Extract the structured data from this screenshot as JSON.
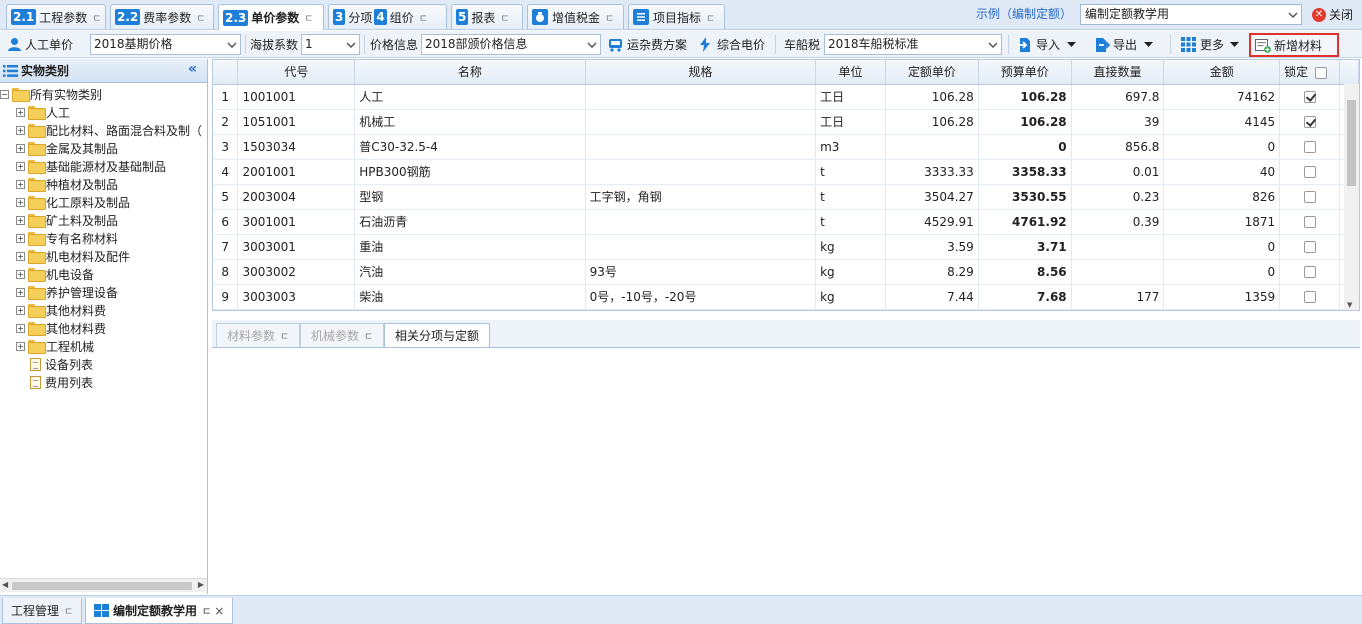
{
  "top_tabs": [
    {
      "num": "2.1",
      "label": "工程参数"
    },
    {
      "num": "2.2",
      "label": "费率参数"
    },
    {
      "num": "2.3",
      "label": "单价参数"
    },
    {
      "num": "3",
      "label": "分项",
      "num2": "4",
      "label2": "组价"
    },
    {
      "num": "5",
      "label": "报表"
    },
    {
      "label": "增值税金"
    },
    {
      "label": "项目指标"
    }
  ],
  "tab_pin_glyph": "ㄷ",
  "demo_label": "示例（编制定额）",
  "project_select": "编制定额教学用",
  "close_label": "关闭",
  "toolbar": {
    "labor_price": "人工单价",
    "labor_price_value": "2018基期价格",
    "altitude_label": "海拔系数",
    "altitude_value": "1",
    "price_info_label": "价格信息",
    "price_info_value": "2018部颁价格信息",
    "freight_label": "运杂费方案",
    "power_label": "综合电价",
    "vehicle_tax_label": "车船税",
    "vehicle_tax_value": "2018车船税标准",
    "import_label": "导入",
    "export_label": "导出",
    "more_label": "更多",
    "new_material_label": "新增材料"
  },
  "left_panel": {
    "title": "实物类别",
    "root": "所有实物类别",
    "items": [
      "人工",
      "配比材料、路面混合料及制（",
      "金属及其制品",
      "基础能源材及基础制品",
      "种植材及制品",
      "化工原料及制品",
      "矿土料及制品",
      "专有名称材料",
      "机电材料及配件",
      "机电设备",
      "养护管理设备",
      "其他材料费",
      "其他材料费",
      "工程机械"
    ],
    "leaf_items": [
      "设备列表",
      "费用列表"
    ]
  },
  "grid": {
    "columns": [
      "代号",
      "名称",
      "规格",
      "单位",
      "定额单价",
      "预算单价",
      "直接数量",
      "金额",
      "锁定"
    ],
    "rows": [
      {
        "n": "1",
        "code": "1001001",
        "name": "人工",
        "spec": "",
        "unit": "工日",
        "quota": "106.28",
        "budget": "106.28",
        "qty": "697.8",
        "amount": "74162",
        "locked": true
      },
      {
        "n": "2",
        "code": "1051001",
        "name": "机械工",
        "spec": "",
        "unit": "工日",
        "quota": "106.28",
        "budget": "106.28",
        "qty": "39",
        "amount": "4145",
        "locked": true
      },
      {
        "n": "3",
        "code": "1503034",
        "name": "普C30-32.5-4",
        "spec": "",
        "unit": "m3",
        "quota": "",
        "budget": "0",
        "qty": "856.8",
        "amount": "0",
        "locked": false
      },
      {
        "n": "4",
        "code": "2001001",
        "name": "HPB300钢筋",
        "spec": "",
        "unit": "t",
        "quota": "3333.33",
        "budget": "3358.33",
        "qty": "0.01",
        "amount": "40",
        "locked": false
      },
      {
        "n": "5",
        "code": "2003004",
        "name": "型钢",
        "spec": "工字钢，角钢",
        "unit": "t",
        "quota": "3504.27",
        "budget": "3530.55",
        "qty": "0.23",
        "amount": "826",
        "locked": false
      },
      {
        "n": "6",
        "code": "3001001",
        "name": "石油沥青",
        "spec": "",
        "unit": "t",
        "quota": "4529.91",
        "budget": "4761.92",
        "qty": "0.39",
        "amount": "1871",
        "locked": false
      },
      {
        "n": "7",
        "code": "3003001",
        "name": "重油",
        "spec": "",
        "unit": "kg",
        "quota": "3.59",
        "budget": "3.71",
        "qty": "",
        "amount": "0",
        "locked": false
      },
      {
        "n": "8",
        "code": "3003002",
        "name": "汽油",
        "spec": "93号",
        "unit": "kg",
        "quota": "8.29",
        "budget": "8.56",
        "qty": "",
        "amount": "0",
        "locked": false
      },
      {
        "n": "9",
        "code": "3003003",
        "name": "柴油",
        "spec": "0号，-10号，-20号",
        "unit": "kg",
        "quota": "7.44",
        "budget": "7.68",
        "qty": "177",
        "amount": "1359",
        "locked": false
      }
    ]
  },
  "bottom_tabs": [
    "材料参数",
    "机械参数",
    "相关分项与定额"
  ],
  "status_tabs": [
    "工程管理",
    "编制定额教学用"
  ],
  "status_close": "×"
}
